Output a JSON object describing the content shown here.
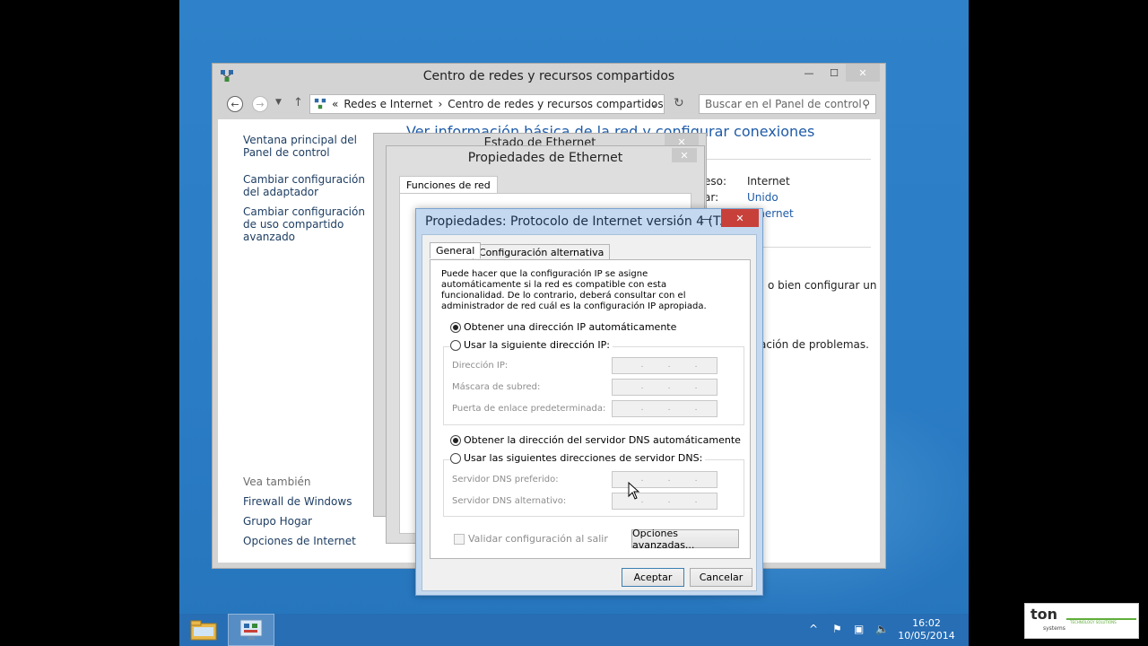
{
  "control_panel": {
    "title": "Centro de redes y recursos compartidos",
    "breadcrumb": {
      "prefix": "«",
      "part1": "Redes e Internet",
      "separator": "›",
      "part2": "Centro de redes y recursos compartidos"
    },
    "search_placeholder": "Buscar en el Panel de control",
    "main_title": "Ver información básica de la red y configurar conexiones",
    "sidebar": {
      "home_link": "Ventana principal del Panel de control",
      "adapter_link": "Cambiar configuración del adaptador",
      "sharing_link": "Cambiar configuración de uso compartido avanzado",
      "see_also": "Vea también",
      "see_also_items": [
        "Firewall de Windows",
        "Grupo Hogar",
        "Opciones de Internet"
      ]
    },
    "right": {
      "access_type_label": "eso:",
      "access_type_value": "Internet",
      "homegroup_label": "ar:",
      "homegroup_value": "Unido",
      "connection_value": "Ethernet",
      "setup_text": "o bien configurar un",
      "troubleshoot_text": "ación de problemas."
    }
  },
  "status_window": {
    "title": "Estado de Ethernet"
  },
  "props_window": {
    "title": "Propiedades de Ethernet",
    "tab": "Funciones de red"
  },
  "ipv4_dialog": {
    "title": "Propiedades: Protocolo de Internet versión 4 (T...",
    "tabs": {
      "general": "General",
      "alternate": "Configuración alternativa"
    },
    "description": "Puede hacer que la configuración IP se asigne automáticamente si la red es compatible con esta funcionalidad. De lo contrario, deberá consultar con el administrador de red cuál es la configuración IP apropiada.",
    "ip_auto": "Obtener una dirección IP automáticamente",
    "ip_manual": "Usar la siguiente dirección IP:",
    "ip_address_label": "Dirección IP:",
    "subnet_label": "Máscara de subred:",
    "gateway_label": "Puerta de enlace predeterminada:",
    "dns_auto": "Obtener la dirección del servidor DNS automáticamente",
    "dns_manual": "Usar las siguientes direcciones de servidor DNS:",
    "dns_preferred_label": "Servidor DNS preferido:",
    "dns_alternate_label": "Servidor DNS alternativo:",
    "validate_label": "Validar configuración al salir",
    "advanced_button": "Opciones avanzadas...",
    "ok_button": "Aceptar",
    "cancel_button": "Cancelar",
    "ip_dots": "."
  },
  "taskbar": {
    "time": "16:02",
    "date": "10/05/2014"
  },
  "logo": {
    "mark": "ton",
    "systems": "systems",
    "tagline": "TECHNOLOGY SOLUTIONS"
  },
  "colors": {
    "desktop": "#2a7cc4",
    "close_red": "#c8403a",
    "link_blue": "#1e5ba8"
  }
}
